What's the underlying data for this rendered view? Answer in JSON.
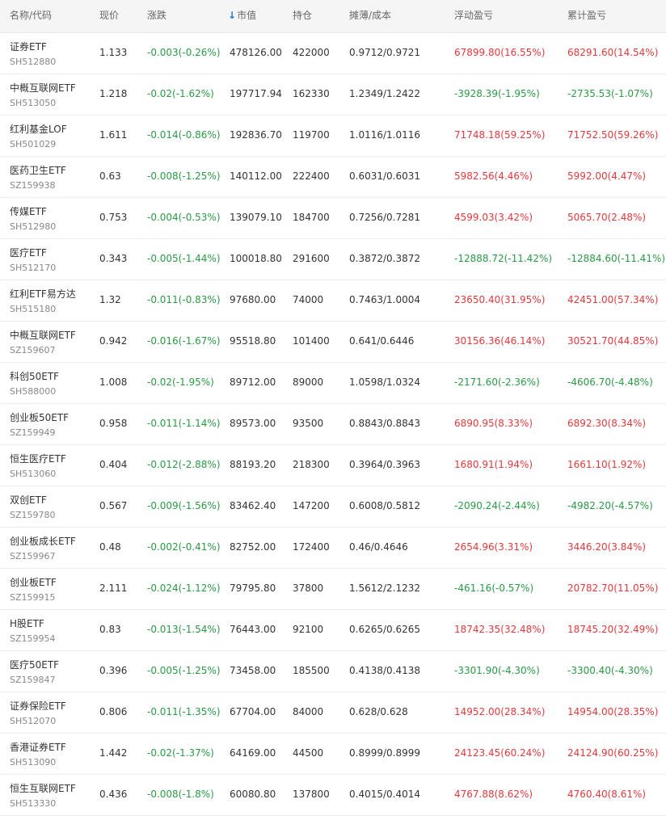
{
  "header": {
    "name_code": "名称/代码",
    "price": "现价",
    "change": "涨跌",
    "sort_arrow": "↓",
    "market_value": "市值",
    "position": "持仓",
    "cost": "摊薄/成本",
    "float_pnl": "浮动盈亏",
    "cum_pnl": "累计盈亏"
  },
  "colors": {
    "up": "#e4393c",
    "down": "#2a9b45",
    "sort": "#1e78c8"
  },
  "rows": [
    {
      "name": "证券ETF",
      "code": "SH512880",
      "price": "1.133",
      "change": "-0.003(-0.26%)",
      "market_value": "478126.00",
      "position": "422000",
      "cost": "0.9712/0.9721",
      "float_pnl": "67899.80(16.55%)",
      "cum_pnl": "68291.60(14.54%)",
      "float_dir": "up",
      "cum_dir": "up"
    },
    {
      "name": "中概互联网ETF",
      "code": "SH513050",
      "price": "1.218",
      "change": "-0.02(-1.62%)",
      "market_value": "197717.94",
      "position": "162330",
      "cost": "1.2349/1.2422",
      "float_pnl": "-3928.39(-1.95%)",
      "cum_pnl": "-2735.53(-1.07%)",
      "float_dir": "down",
      "cum_dir": "down"
    },
    {
      "name": "红利基金LOF",
      "code": "SH501029",
      "price": "1.611",
      "change": "-0.014(-0.86%)",
      "market_value": "192836.70",
      "position": "119700",
      "cost": "1.0116/1.0116",
      "float_pnl": "71748.18(59.25%)",
      "cum_pnl": "71752.50(59.26%)",
      "float_dir": "up",
      "cum_dir": "up"
    },
    {
      "name": "医药卫生ETF",
      "code": "SZ159938",
      "price": "0.63",
      "change": "-0.008(-1.25%)",
      "market_value": "140112.00",
      "position": "222400",
      "cost": "0.6031/0.6031",
      "float_pnl": "5982.56(4.46%)",
      "cum_pnl": "5992.00(4.47%)",
      "float_dir": "up",
      "cum_dir": "up"
    },
    {
      "name": "传媒ETF",
      "code": "SH512980",
      "price": "0.753",
      "change": "-0.004(-0.53%)",
      "market_value": "139079.10",
      "position": "184700",
      "cost": "0.7256/0.7281",
      "float_pnl": "4599.03(3.42%)",
      "cum_pnl": "5065.70(2.48%)",
      "float_dir": "up",
      "cum_dir": "up"
    },
    {
      "name": "医疗ETF",
      "code": "SH512170",
      "price": "0.343",
      "change": "-0.005(-1.44%)",
      "market_value": "100018.80",
      "position": "291600",
      "cost": "0.3872/0.3872",
      "float_pnl": "-12888.72(-11.42%)",
      "cum_pnl": "-12884.60(-11.41%)",
      "float_dir": "down",
      "cum_dir": "down"
    },
    {
      "name": "红利ETF易方达",
      "code": "SH515180",
      "price": "1.32",
      "change": "-0.011(-0.83%)",
      "market_value": "97680.00",
      "position": "74000",
      "cost": "0.7463/1.0004",
      "float_pnl": "23650.40(31.95%)",
      "cum_pnl": "42451.00(57.34%)",
      "float_dir": "up",
      "cum_dir": "up"
    },
    {
      "name": "中概互联网ETF",
      "code": "SZ159607",
      "price": "0.942",
      "change": "-0.016(-1.67%)",
      "market_value": "95518.80",
      "position": "101400",
      "cost": "0.641/0.6446",
      "float_pnl": "30156.36(46.14%)",
      "cum_pnl": "30521.70(44.85%)",
      "float_dir": "up",
      "cum_dir": "up"
    },
    {
      "name": "科创50ETF",
      "code": "SH588000",
      "price": "1.008",
      "change": "-0.02(-1.95%)",
      "market_value": "89712.00",
      "position": "89000",
      "cost": "1.0598/1.0324",
      "float_pnl": "-2171.60(-2.36%)",
      "cum_pnl": "-4606.70(-4.48%)",
      "float_dir": "down",
      "cum_dir": "down"
    },
    {
      "name": "创业板50ETF",
      "code": "SZ159949",
      "price": "0.958",
      "change": "-0.011(-1.14%)",
      "market_value": "89573.00",
      "position": "93500",
      "cost": "0.8843/0.8843",
      "float_pnl": "6890.95(8.33%)",
      "cum_pnl": "6892.30(8.34%)",
      "float_dir": "up",
      "cum_dir": "up"
    },
    {
      "name": "恒生医疗ETF",
      "code": "SH513060",
      "price": "0.404",
      "change": "-0.012(-2.88%)",
      "market_value": "88193.20",
      "position": "218300",
      "cost": "0.3964/0.3963",
      "float_pnl": "1680.91(1.94%)",
      "cum_pnl": "1661.10(1.92%)",
      "float_dir": "up",
      "cum_dir": "up"
    },
    {
      "name": "双创ETF",
      "code": "SZ159780",
      "price": "0.567",
      "change": "-0.009(-1.56%)",
      "market_value": "83462.40",
      "position": "147200",
      "cost": "0.6008/0.5812",
      "float_pnl": "-2090.24(-2.44%)",
      "cum_pnl": "-4982.20(-4.57%)",
      "float_dir": "down",
      "cum_dir": "down"
    },
    {
      "name": "创业板成长ETF",
      "code": "SZ159967",
      "price": "0.48",
      "change": "-0.002(-0.41%)",
      "market_value": "82752.00",
      "position": "172400",
      "cost": "0.46/0.4646",
      "float_pnl": "2654.96(3.31%)",
      "cum_pnl": "3446.20(3.84%)",
      "float_dir": "up",
      "cum_dir": "up"
    },
    {
      "name": "创业板ETF",
      "code": "SZ159915",
      "price": "2.111",
      "change": "-0.024(-1.12%)",
      "market_value": "79795.80",
      "position": "37800",
      "cost": "1.5612/2.1232",
      "float_pnl": "-461.16(-0.57%)",
      "cum_pnl": "20782.70(11.05%)",
      "float_dir": "down",
      "cum_dir": "up"
    },
    {
      "name": "H股ETF",
      "code": "SZ159954",
      "price": "0.83",
      "change": "-0.013(-1.54%)",
      "market_value": "76443.00",
      "position": "92100",
      "cost": "0.6265/0.6265",
      "float_pnl": "18742.35(32.48%)",
      "cum_pnl": "18745.20(32.49%)",
      "float_dir": "up",
      "cum_dir": "up"
    },
    {
      "name": "医疗50ETF",
      "code": "SZ159847",
      "price": "0.396",
      "change": "-0.005(-1.25%)",
      "market_value": "73458.00",
      "position": "185500",
      "cost": "0.4138/0.4138",
      "float_pnl": "-3301.90(-4.30%)",
      "cum_pnl": "-3300.40(-4.30%)",
      "float_dir": "down",
      "cum_dir": "down"
    },
    {
      "name": "证券保险ETF",
      "code": "SH512070",
      "price": "0.806",
      "change": "-0.011(-1.35%)",
      "market_value": "67704.00",
      "position": "84000",
      "cost": "0.628/0.628",
      "float_pnl": "14952.00(28.34%)",
      "cum_pnl": "14954.00(28.35%)",
      "float_dir": "up",
      "cum_dir": "up"
    },
    {
      "name": "香港证券ETF",
      "code": "SH513090",
      "price": "1.442",
      "change": "-0.02(-1.37%)",
      "market_value": "64169.00",
      "position": "44500",
      "cost": "0.8999/0.8999",
      "float_pnl": "24123.45(60.24%)",
      "cum_pnl": "24124.90(60.25%)",
      "float_dir": "up",
      "cum_dir": "up"
    },
    {
      "name": "恒生互联网ETF",
      "code": "SH513330",
      "price": "0.436",
      "change": "-0.008(-1.8%)",
      "market_value": "60080.80",
      "position": "137800",
      "cost": "0.4015/0.4014",
      "float_pnl": "4767.88(8.62%)",
      "cum_pnl": "4760.40(8.61%)",
      "float_dir": "up",
      "cum_dir": "up"
    }
  ]
}
